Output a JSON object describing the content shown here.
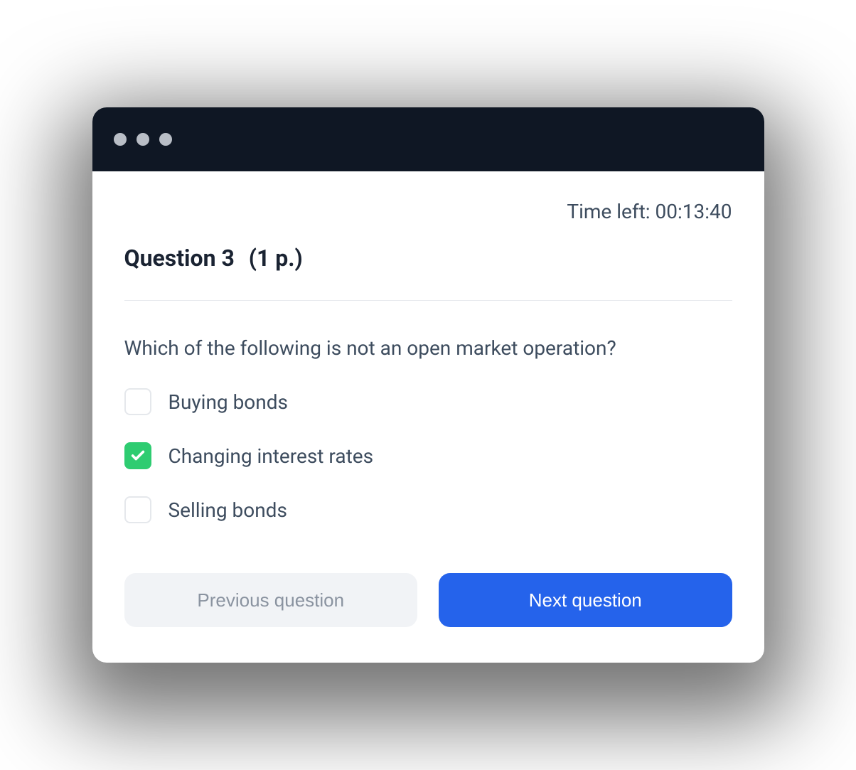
{
  "timer": {
    "label": "Time left:",
    "value": "00:13:40"
  },
  "question": {
    "title": "Question 3",
    "points": "(1 p.)",
    "text": "Which of the following is not an open market operation?"
  },
  "options": [
    {
      "label": "Buying bonds",
      "checked": false
    },
    {
      "label": "Changing interest rates",
      "checked": true
    },
    {
      "label": "Selling bonds",
      "checked": false
    }
  ],
  "buttons": {
    "previous": "Previous question",
    "next": "Next question"
  }
}
